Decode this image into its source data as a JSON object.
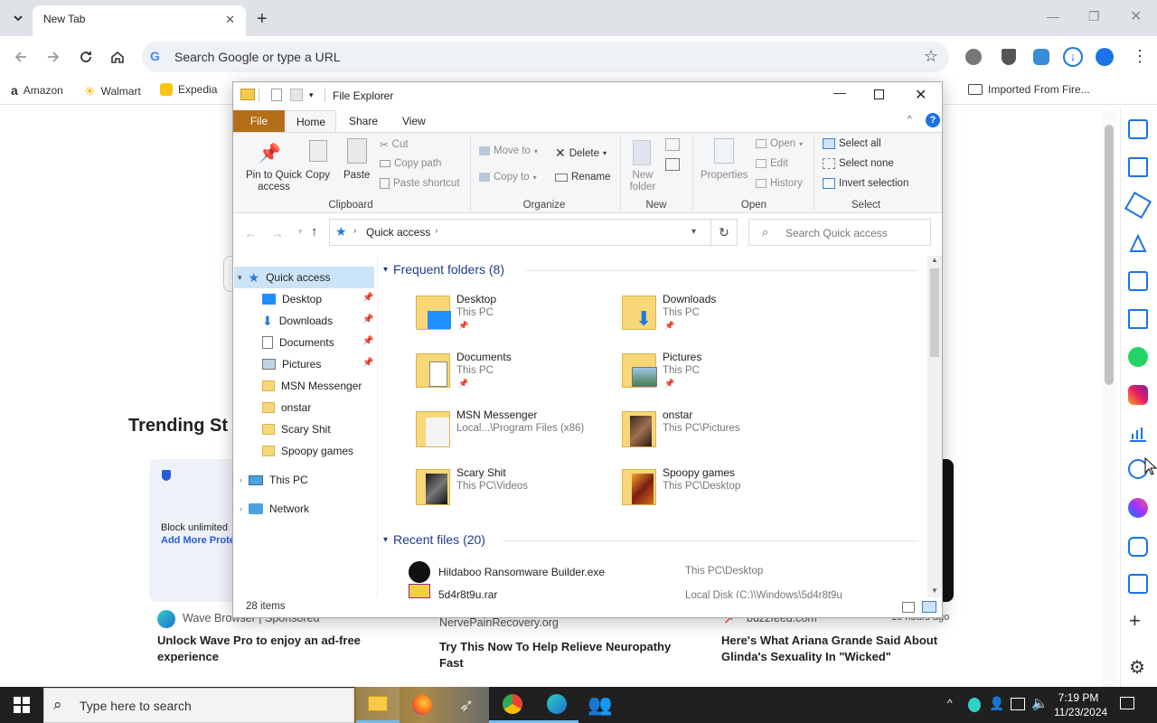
{
  "browser": {
    "tab_title": "New Tab",
    "omnibox_placeholder": "Search Google or type a URL",
    "bookmarks": [
      "Amazon",
      "Walmart",
      "Expedia",
      "Imported From Fire..."
    ]
  },
  "page": {
    "trending_heading": "Trending St",
    "ad_text_1": "Block unlimited",
    "ad_text_2": "Add More Prote",
    "cards": [
      {
        "source": "Wave Browser | Sponsored",
        "title": "Unlock Wave Pro to enjoy an ad-free experience"
      },
      {
        "source": "NervePainRecovery.org",
        "title": "Try This Now To Help Relieve Neuropathy Fast"
      },
      {
        "source": "buzzfeed.com",
        "time": "10 hours ago",
        "title": "Here's What Ariana Grande Said About Glinda's Sexuality In \"Wicked\""
      }
    ]
  },
  "explorer": {
    "title": "File Explorer",
    "ribbon_tabs": [
      "File",
      "Home",
      "Share",
      "View"
    ],
    "clipboard": {
      "pin": "Pin to Quick access",
      "copy": "Copy",
      "paste": "Paste",
      "cut": "Cut",
      "copy_path": "Copy path",
      "paste_shortcut": "Paste shortcut",
      "group": "Clipboard"
    },
    "organize": {
      "move_to": "Move to",
      "copy_to": "Copy to",
      "delete": "Delete",
      "rename": "Rename",
      "group": "Organize"
    },
    "new": {
      "new_folder": "New folder",
      "group": "New"
    },
    "open": {
      "properties": "Properties",
      "open": "Open",
      "edit": "Edit",
      "history": "History",
      "group": "Open"
    },
    "select": {
      "select_all": "Select all",
      "select_none": "Select none",
      "invert": "Invert selection",
      "group": "Select"
    },
    "address": "Quick access",
    "search_placeholder": "Search Quick access",
    "nav": {
      "quick_access": "Quick access",
      "items": [
        "Desktop",
        "Downloads",
        "Documents",
        "Pictures",
        "MSN Messenger",
        "onstar",
        "Scary Shit",
        "Spoopy games"
      ],
      "this_pc": "This PC",
      "network": "Network"
    },
    "frequent_header": "Frequent folders (8)",
    "folders": [
      {
        "name": "Desktop",
        "path": "This PC"
      },
      {
        "name": "Downloads",
        "path": "This PC"
      },
      {
        "name": "Documents",
        "path": "This PC"
      },
      {
        "name": "Pictures",
        "path": "This PC"
      },
      {
        "name": "MSN Messenger",
        "path": "Local...\\Program Files (x86)"
      },
      {
        "name": "onstar",
        "path": "This PC\\Pictures"
      },
      {
        "name": "Scary Shit",
        "path": "This PC\\Videos"
      },
      {
        "name": "Spoopy games",
        "path": "This PC\\Desktop"
      }
    ],
    "recent_header": "Recent files (20)",
    "recent": [
      {
        "name": "Hildaboo Ransomware Builder.exe",
        "path": "This PC\\Desktop"
      },
      {
        "name": "5d4r8t9u.rar",
        "path": "Local Disk (C:)\\Windows\\5d4r8t9u"
      }
    ],
    "status": "28 items"
  },
  "taskbar": {
    "search_placeholder": "Type here to search",
    "time": "7:19 PM",
    "date": "11/23/2024"
  }
}
